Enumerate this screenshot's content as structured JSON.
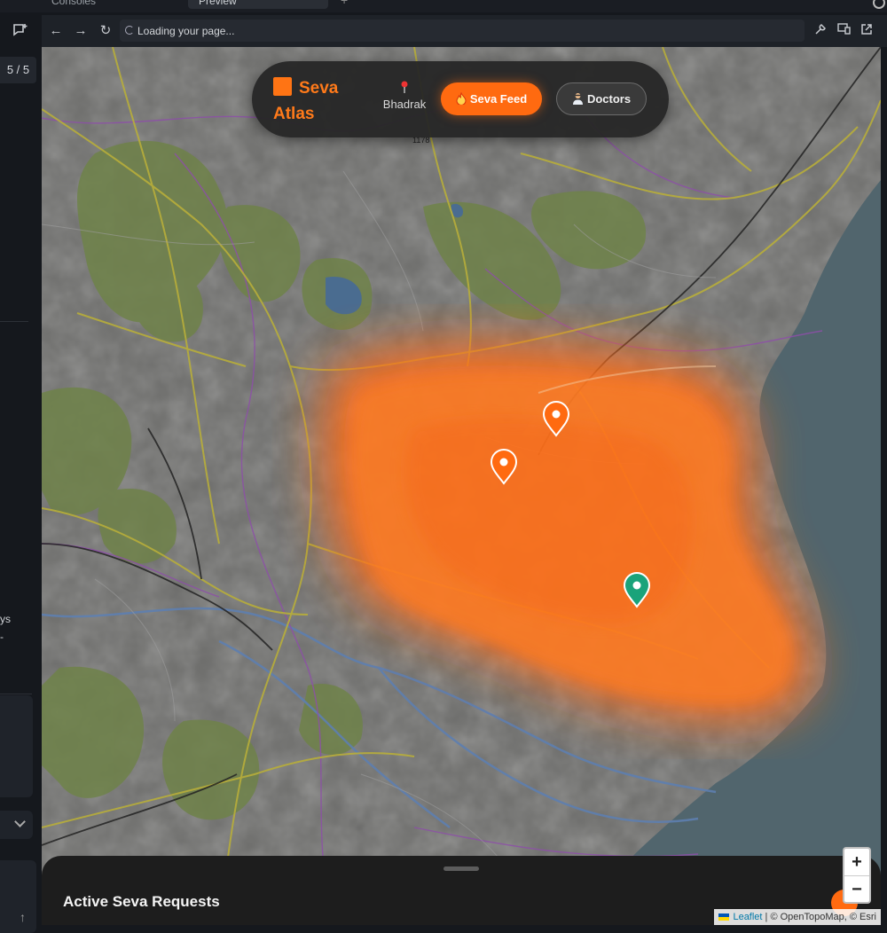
{
  "ide": {
    "tabs": [
      "Consoles",
      "Preview"
    ],
    "page_count": "5 / 5",
    "rail_fragments": [
      "ys",
      "-"
    ]
  },
  "browser": {
    "url_text": "Loading your page..."
  },
  "header": {
    "brand": "Seva Atlas",
    "location": "Bhadrak",
    "feed_button": "Seva Feed",
    "doctors_button": "Doctors",
    "accent": "#ff6a10"
  },
  "map": {
    "markers": [
      {
        "type": "request",
        "color": "#ff6a10"
      },
      {
        "type": "request",
        "color": "#ff6a10"
      },
      {
        "type": "doctor",
        "color": "#1aa37a"
      }
    ],
    "labels": {
      "road_ref": "1178"
    },
    "zoom_in": "+",
    "zoom_out": "−",
    "attribution_link": "Leaflet",
    "attribution_text": "| © OpenTopoMap, © Esri"
  },
  "sheet": {
    "title": "Active Seva Requests"
  }
}
